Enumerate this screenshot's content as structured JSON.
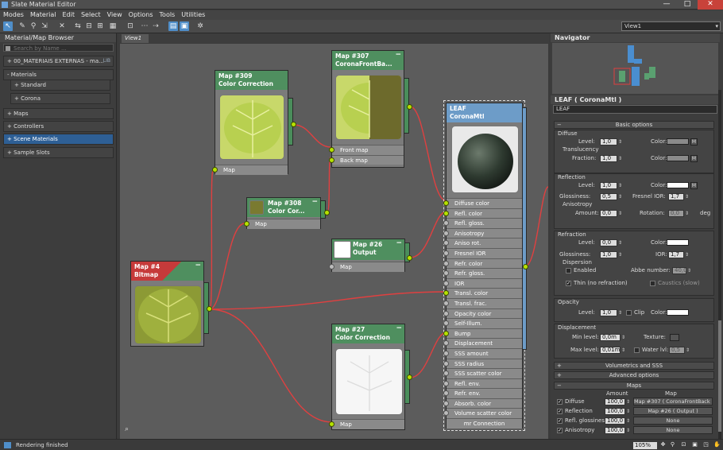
{
  "window": {
    "title": "Slate Material Editor",
    "controls": [
      "—",
      "□",
      "✕"
    ]
  },
  "menu": [
    "Modes",
    "Material",
    "Edit",
    "Select",
    "View",
    "Options",
    "Tools",
    "Utilities"
  ],
  "toolbar": {
    "view_select": "View1"
  },
  "browser": {
    "title": "Material/Map Browser",
    "search_placeholder": "Search by Name ...",
    "rows": {
      "lib": "+ 00_MATERIAIS EXTERNAS - ma...",
      "lib_tag": "LIB",
      "materials": "- Materials",
      "standard": "+ Standard",
      "corona": "+ Corona",
      "maps": "+ Maps",
      "controllers": "+ Controllers",
      "scene": "+ Scene Materials",
      "samples": "+ Sample Slots"
    }
  },
  "view": {
    "tab": "View1"
  },
  "nodes": {
    "n309": {
      "id": "Map #309",
      "type": "Color Correction",
      "slot": "Map"
    },
    "n307": {
      "id": "Map #307",
      "type": "CoronaFrontBa...",
      "slots": [
        "Front map",
        "Back map"
      ]
    },
    "n308": {
      "id": "Map #308",
      "type": "Color Cor...",
      "slot": "Map"
    },
    "n26": {
      "id": "Map #26",
      "type": "Output",
      "slot": "Map"
    },
    "n4": {
      "id": "Map #4",
      "type": "Bitmap"
    },
    "n27": {
      "id": "Map #27",
      "type": "Color Correction",
      "slot": "Map"
    },
    "leaf": {
      "id": "LEAF",
      "type": "CoronaMtl",
      "slots": [
        "Diffuse color",
        "Refl. color",
        "Refl. gloss.",
        "Anisotropy",
        "Aniso rot.",
        "Fresnel IOR",
        "Refr. color",
        "Refr. gloss.",
        "IOR",
        "Transl. color",
        "Transl. frac.",
        "Opacity color",
        "Self-Illum.",
        "Bump",
        "Displacement",
        "SSS amount",
        "SSS radius",
        "SSS scatter color",
        "Refl. env.",
        "Refr. env.",
        "Absorb. color",
        "Volume scatter color",
        "mr Connection"
      ]
    }
  },
  "navigator": {
    "title": "Navigator"
  },
  "params": {
    "title": "LEAF  ( CoronaMtl )",
    "name": "LEAF",
    "basic_options": "Basic options",
    "diffuse": {
      "header": "Diffuse",
      "level_label": "Level:",
      "level": "1,0",
      "color_label": "Color:",
      "m": "M",
      "translucency": "Translucency",
      "fraction_label": "Fraction:",
      "fraction": "1,0"
    },
    "reflection": {
      "header": "Reflection",
      "level_label": "Level:",
      "level": "1,0",
      "color_label": "Color:",
      "m": "M",
      "gloss_label": "Glossiness:",
      "gloss": "0,5",
      "fresnel_label": "Fresnel IOR:",
      "fresnel": "1,7",
      "aniso": "Anisotropy",
      "amount_label": "Amount:",
      "amount": "0,0",
      "rotation_label": "Rotation:",
      "rotation": "0,0",
      "deg": "deg"
    },
    "refraction": {
      "header": "Refraction",
      "level_label": "Level:",
      "level": "0,0",
      "color_label": "Color:",
      "gloss_label": "Glossiness:",
      "gloss": "1,0",
      "ior_label": "IOR:",
      "ior": "1,7",
      "dispersion": "Dispersion",
      "enabled": "Enabled",
      "abbe_label": "Abbe number:",
      "abbe": "40,0",
      "thin": "Thin (no refraction)",
      "caustics": "Caustics (slow)"
    },
    "opacity": {
      "header": "Opacity",
      "level_label": "Level:",
      "level": "1,0",
      "clip": "Clip",
      "color_label": "Color:"
    },
    "displacement": {
      "header": "Displacement",
      "min_label": "Min level:",
      "min": "0,0m",
      "texture_label": "Texture:",
      "max_label": "Max level:",
      "max": "0,01m",
      "water": "Water lvl:",
      "water_val": "0,5"
    },
    "volumetrics": "Volumetrics and SSS",
    "advanced": "Advanced options",
    "maps": {
      "header": "Maps",
      "col_amount": "Amount",
      "col_map": "Map",
      "rows": [
        {
          "name": "Diffuse",
          "amount": "100,0",
          "map": "Map #307  ( CoronaFrontBack )"
        },
        {
          "name": "Reflection",
          "amount": "100,0",
          "map": "Map #26  ( Output )"
        },
        {
          "name": "Refl. glossiness",
          "amount": "100,0",
          "map": "None"
        },
        {
          "name": "Anisotropy",
          "amount": "100,0",
          "map": "None"
        }
      ]
    }
  },
  "status": {
    "text": "Rendering finished",
    "zoom": "105%"
  },
  "colors": {
    "accent": "#4f8ec9",
    "wire": "#e04040",
    "port": "#b6e200"
  }
}
